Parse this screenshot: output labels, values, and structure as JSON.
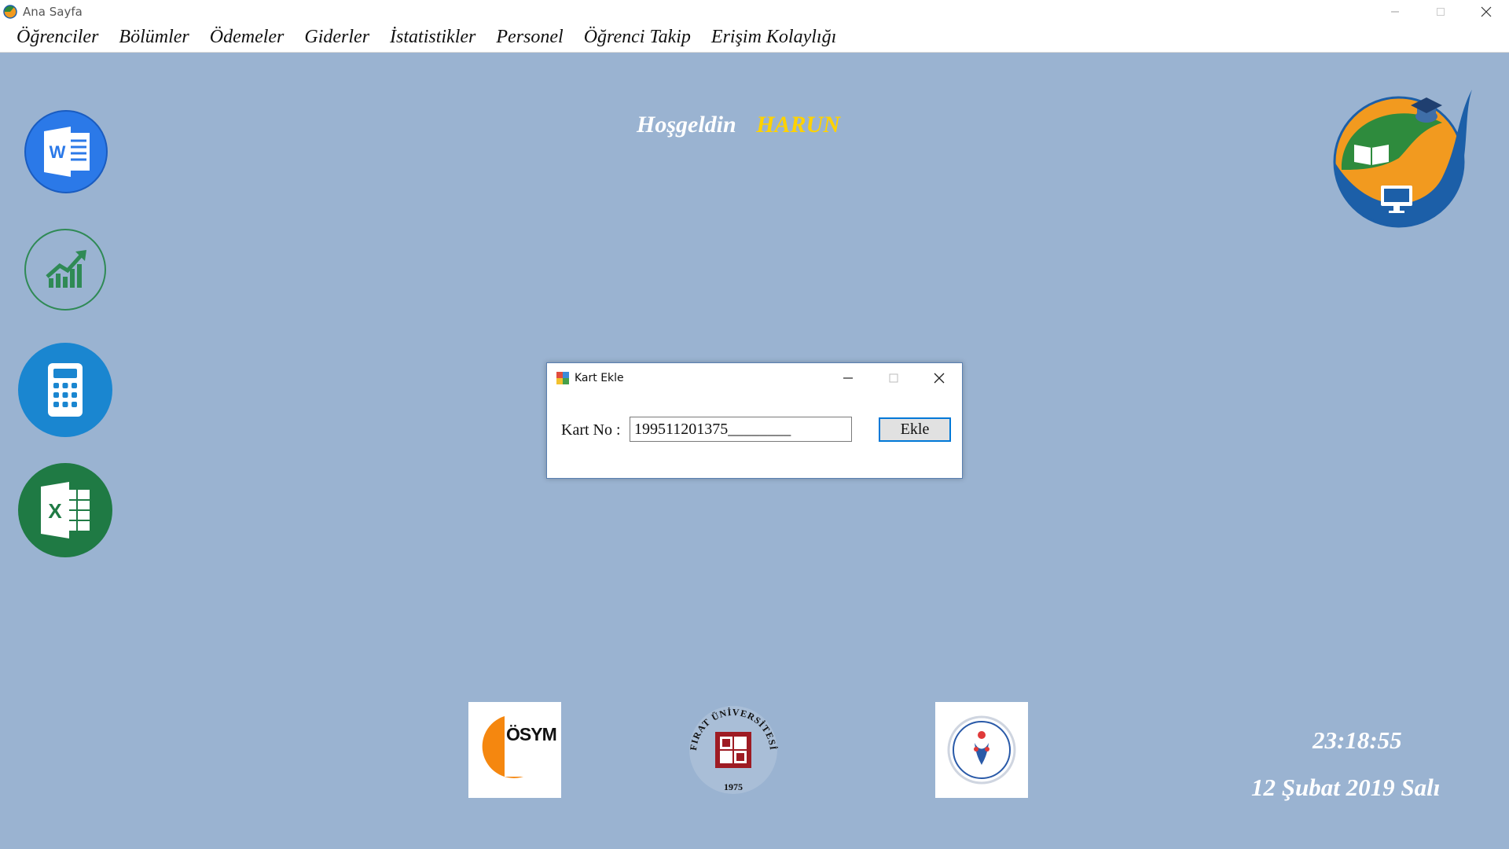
{
  "window": {
    "title": "Ana Sayfa"
  },
  "menu": {
    "items": [
      "Öğrenciler",
      "Bölümler",
      "Ödemeler",
      "Giderler",
      "İstatistikler",
      "Personel",
      "Öğrenci Takip",
      "Erişim Kolaylığı"
    ]
  },
  "welcome": {
    "greeting": "Hoşgeldin",
    "user": "HARUN"
  },
  "sidebar": {
    "icons": [
      "word-icon",
      "chart-growth-icon",
      "calculator-icon",
      "excel-icon"
    ]
  },
  "dialog": {
    "title": "Kart Ekle",
    "card_label": "Kart No :",
    "card_value": "199511201375________",
    "add_button": "Ekle"
  },
  "logos": {
    "left": "ÖSYM",
    "center_top": "FIRAT ÜNİVERSİTESİ",
    "center_year": "1975"
  },
  "clock": {
    "time": "23:18:55",
    "date": "12 Şubat 2019 Salı"
  },
  "colors": {
    "background": "#9ab3d1",
    "welcome_user": "#ffd200",
    "button_border": "#0078d7"
  }
}
